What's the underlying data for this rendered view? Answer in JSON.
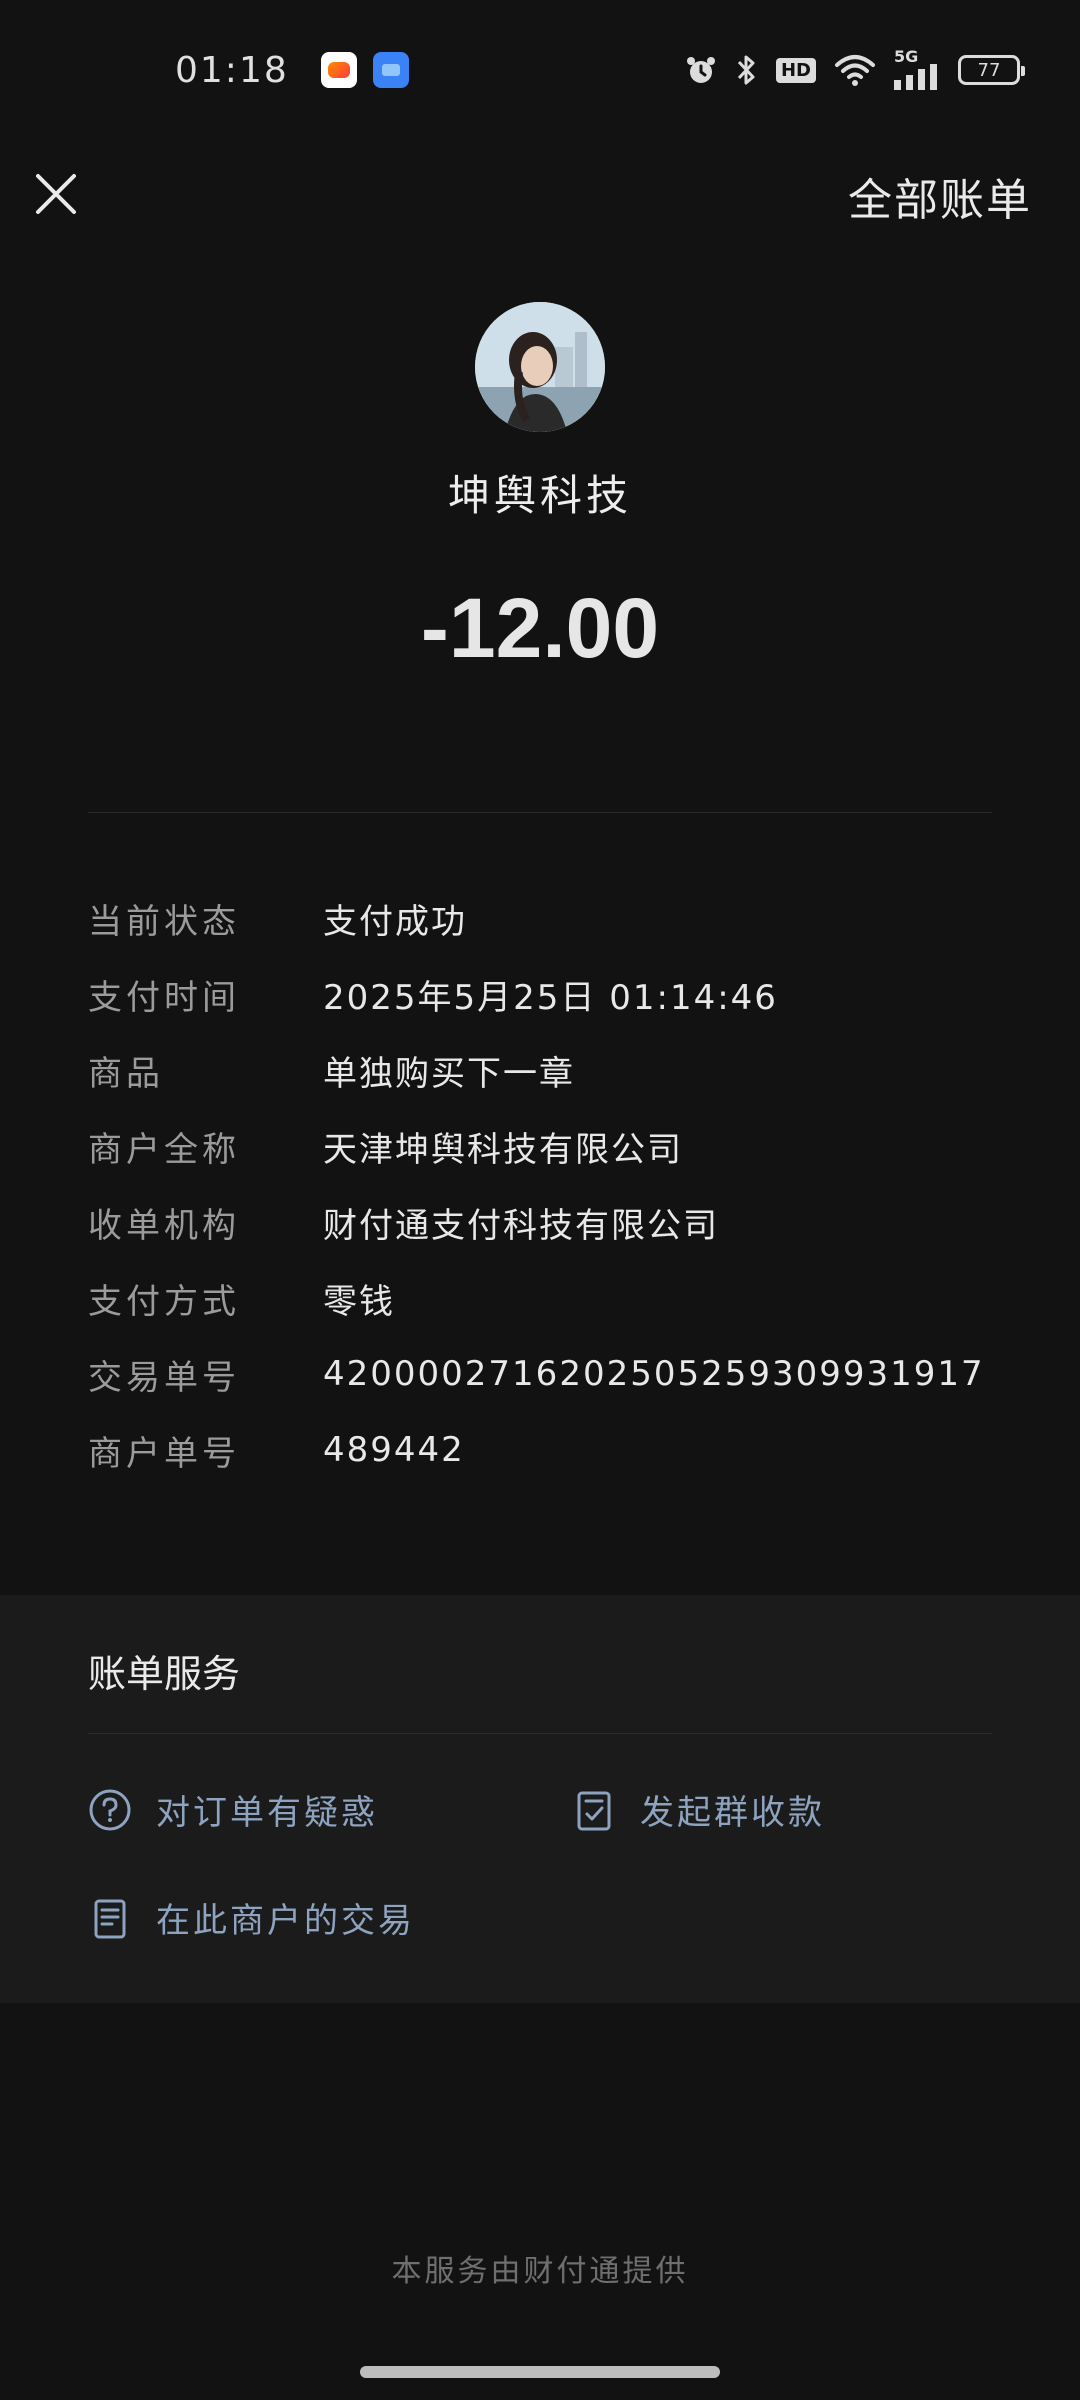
{
  "status_bar": {
    "time": "01:18",
    "network": "5G",
    "hd": "HD",
    "battery": "77"
  },
  "header": {
    "all_bills_label": "全部账单"
  },
  "merchant": {
    "name": "坤舆科技",
    "amount": "-12.00"
  },
  "details": [
    {
      "label": "当前状态",
      "value": "支付成功"
    },
    {
      "label": "支付时间",
      "value": "2025年5月25日 01:14:46"
    },
    {
      "label": "商品",
      "value": "单独购买下一章"
    },
    {
      "label": "商户全称",
      "value": "天津坤舆科技有限公司"
    },
    {
      "label": "收单机构",
      "value": "财付通支付科技有限公司"
    },
    {
      "label": "支付方式",
      "value": "零钱"
    },
    {
      "label": "交易单号",
      "value": "4200002716202505259309931917"
    },
    {
      "label": "商户单号",
      "value": "489442"
    }
  ],
  "services": {
    "title": "账单服务",
    "items": [
      {
        "label": "对订单有疑惑",
        "icon": "question-circle-icon"
      },
      {
        "label": "发起群收款",
        "icon": "checklist-icon"
      },
      {
        "label": "在此商户的交易",
        "icon": "document-icon"
      }
    ]
  },
  "footer": {
    "note": "本服务由财付通提供"
  }
}
